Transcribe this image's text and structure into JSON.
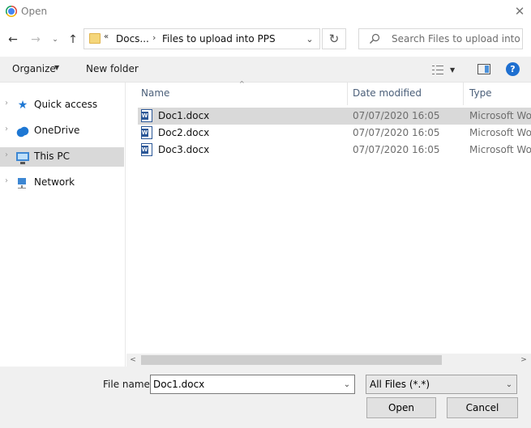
{
  "window": {
    "title": "Open",
    "close_glyph": "✕"
  },
  "nav": {
    "back_glyph": "←",
    "forward_glyph": "→",
    "recent_glyph": "⌄",
    "up_glyph": "↑"
  },
  "address": {
    "overflow": "«",
    "crumbs": [
      "Docs...",
      "Files to upload into PPS"
    ],
    "separator": "›",
    "dropdown_glyph": "⌄",
    "refresh_glyph": "↻"
  },
  "search": {
    "placeholder": "Search Files to upload into P..."
  },
  "toolbar": {
    "organize_label": "Organize",
    "caret": "▼",
    "new_folder_label": "New folder",
    "help_glyph": "?"
  },
  "sidebar": {
    "items": [
      {
        "label": "Quick access",
        "icon": "star-icon"
      },
      {
        "label": "OneDrive",
        "icon": "cloud-icon"
      },
      {
        "label": "This PC",
        "icon": "computer-icon",
        "selected": true
      },
      {
        "label": "Network",
        "icon": "network-icon"
      }
    ],
    "chevron": "›"
  },
  "filelist": {
    "columns": {
      "name": "Name",
      "date": "Date modified",
      "type": "Type"
    },
    "sort_glyph": "^",
    "rows": [
      {
        "name": "Doc1.docx",
        "date": "07/07/2020 16:05",
        "type": "Microsoft Word Document",
        "selected": true
      },
      {
        "name": "Doc2.docx",
        "date": "07/07/2020 16:05",
        "type": "Microsoft Word Document"
      },
      {
        "name": "Doc3.docx",
        "date": "07/07/2020 16:05",
        "type": "Microsoft Word Document"
      }
    ]
  },
  "scroll": {
    "left_glyph": "<",
    "right_glyph": ">"
  },
  "footer": {
    "file_name_label": "File name:",
    "file_name_value": "Doc1.docx",
    "dropdown_glyph": "⌄",
    "filter_value": "All Files (*.*)",
    "open_label": "Open",
    "cancel_label": "Cancel"
  },
  "colors": {
    "selection": "#d9d9d9",
    "accent": "#1e77d3",
    "toolbar_bg": "#f0f0f0"
  }
}
